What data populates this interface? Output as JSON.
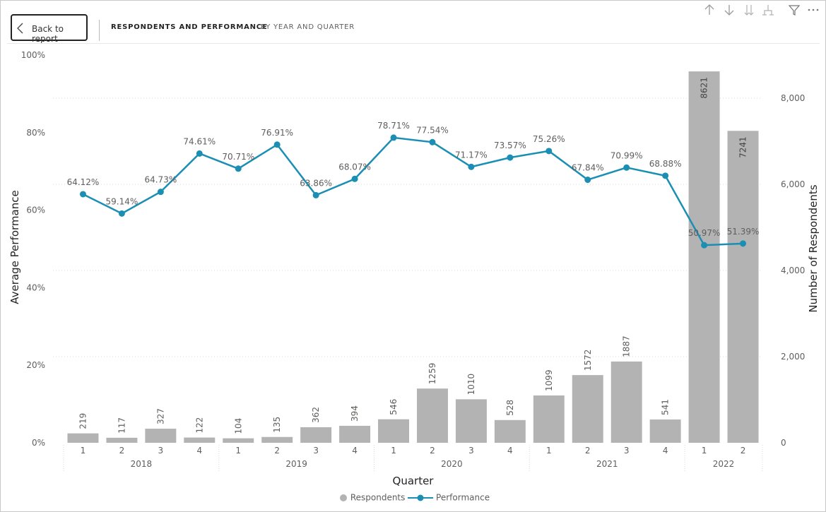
{
  "nav": {
    "back_label": "Back to report",
    "crumb_active": "RESPONDENTS AND PERFORMANCE",
    "crumb_inactive": "BY YEAR AND QUARTER"
  },
  "toolbar": {
    "icons": [
      "arrow-up-icon",
      "arrow-down-icon",
      "double-arrow-down-icon",
      "expand-hierarchy-icon",
      "filter-icon",
      "more-options-icon"
    ]
  },
  "colors": {
    "bar": "#b3b3b3",
    "line": "#1a8fb3",
    "label": "#605e5c",
    "grid": "#d9d9d9"
  },
  "chart_data": {
    "type": "bar+line",
    "xlabel": "Quarter",
    "ylabel_left": "Average Performance",
    "ylabel_right": "Number of Respondents",
    "left_axis": {
      "min": 0,
      "max": 100,
      "ticks": [
        "0%",
        "20%",
        "40%",
        "60%",
        "80%",
        "100%"
      ]
    },
    "right_axis": {
      "min": 0,
      "max": 9000,
      "ticks": [
        "0",
        "2,000",
        "4,000",
        "6,000",
        "8,000"
      ]
    },
    "grid": true,
    "legend_position": "bottom-center",
    "years": [
      {
        "label": "2018",
        "quarters": [
          "1",
          "2",
          "3",
          "4"
        ]
      },
      {
        "label": "2019",
        "quarters": [
          "1",
          "2",
          "3",
          "4"
        ]
      },
      {
        "label": "2020",
        "quarters": [
          "1",
          "2",
          "3",
          "4"
        ]
      },
      {
        "label": "2021",
        "quarters": [
          "1",
          "2",
          "3",
          "4"
        ]
      },
      {
        "label": "2022",
        "quarters": [
          "1",
          "2"
        ]
      }
    ],
    "series": [
      {
        "name": "Respondents",
        "kind": "bar",
        "axis": "right",
        "values": [
          219,
          117,
          327,
          122,
          104,
          135,
          362,
          394,
          546,
          1259,
          1010,
          528,
          1099,
          1572,
          1887,
          541,
          8621,
          7241
        ],
        "labels": [
          "219",
          "117",
          "327",
          "122",
          "104",
          "135",
          "362",
          "394",
          "546",
          "1259",
          "1010",
          "528",
          "1099",
          "1572",
          "1887",
          "541",
          "8621",
          "7241"
        ]
      },
      {
        "name": "Performance",
        "kind": "line",
        "axis": "left",
        "values": [
          64.12,
          59.14,
          64.73,
          74.61,
          70.71,
          76.91,
          63.86,
          68.07,
          78.71,
          77.54,
          71.17,
          73.57,
          75.26,
          67.84,
          70.99,
          68.88,
          50.97,
          51.39
        ],
        "labels": [
          "64.12%",
          "59.14%",
          "64.73%",
          "74.61%",
          "70.71%",
          "76.91%",
          "63.86%",
          "68.07%",
          "78.71%",
          "77.54%",
          "71.17%",
          "73.57%",
          "75.26%",
          "67.84%",
          "70.99%",
          "68.88%",
          "50.97%",
          "51.39%"
        ]
      }
    ]
  }
}
